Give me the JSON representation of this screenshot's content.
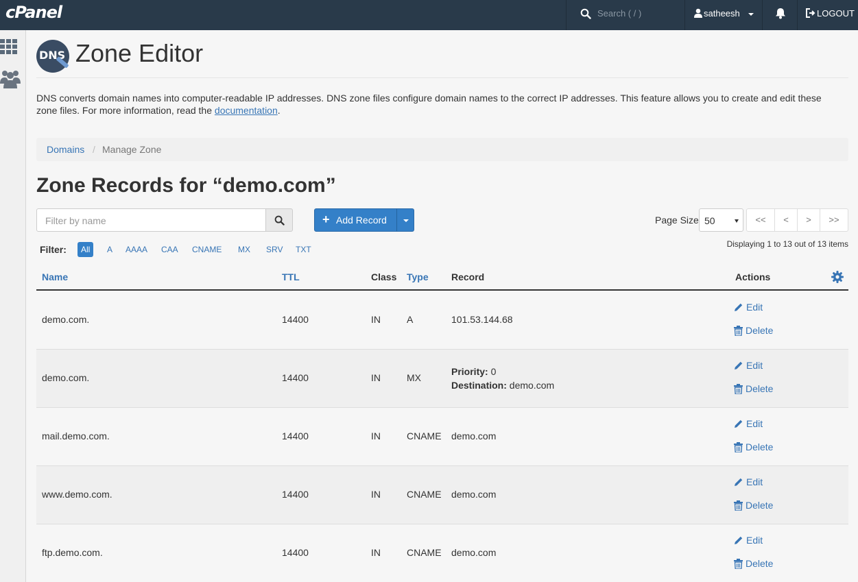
{
  "topbar": {
    "logo": "cPanel",
    "search_placeholder": "Search ( / )",
    "username": "satheesh",
    "logout": "LOGOUT"
  },
  "header": {
    "logo_text": "DNS",
    "title": "Zone Editor"
  },
  "description": {
    "text": "DNS converts domain names into computer-readable IP addresses. DNS zone files configure domain names to the correct IP addresses. This feature allows you to create and edit these zone files. For more information, read the ",
    "link": "documentation",
    "end": "."
  },
  "breadcrumb": {
    "root": "Domains",
    "separator": "/",
    "current": "Manage Zone"
  },
  "zone_title": "Zone Records for “demo.com”",
  "toolbar": {
    "filter_placeholder": "Filter by name",
    "add_record": "Add Record",
    "page_size_label": "Page Size",
    "page_size_value": "50",
    "pager": {
      "first": "<<",
      "prev": "<",
      "next": ">",
      "last": ">>"
    },
    "displaying": "Displaying 1 to 13 out of 13 items"
  },
  "filters": {
    "label": "Filter:",
    "options": [
      "All",
      "A",
      "AAAA",
      "CAA",
      "CNAME",
      "MX",
      "SRV",
      "TXT"
    ],
    "active": "All"
  },
  "table": {
    "columns": {
      "name": "Name",
      "ttl": "TTL",
      "class": "Class",
      "type": "Type",
      "record": "Record",
      "actions": "Actions"
    },
    "edit_label": "Edit",
    "delete_label": "Delete",
    "rows": [
      {
        "name": "demo.com.",
        "ttl": "14400",
        "class": "IN",
        "type": "A",
        "record": "101.53.144.68"
      },
      {
        "name": "demo.com.",
        "ttl": "14400",
        "class": "IN",
        "type": "MX",
        "priority_label": "Priority:",
        "priority": "0",
        "destination_label": "Destination:",
        "destination": "demo.com"
      },
      {
        "name": "mail.demo.com.",
        "ttl": "14400",
        "class": "IN",
        "type": "CNAME",
        "record": "demo.com"
      },
      {
        "name": "www.demo.com.",
        "ttl": "14400",
        "class": "IN",
        "type": "CNAME",
        "record": "demo.com"
      },
      {
        "name": "ftp.demo.com.",
        "ttl": "14400",
        "class": "IN",
        "type": "CNAME",
        "record": "demo.com"
      }
    ]
  },
  "colors": {
    "topbar": "#293a4a",
    "accent": "#3480c8",
    "link": "#3875b5"
  }
}
